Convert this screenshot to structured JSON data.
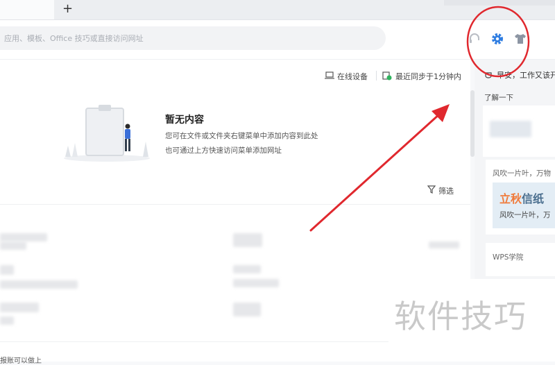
{
  "tabbar": {
    "new_tab_label": "+"
  },
  "toolbar": {
    "search_placeholder": "应用、模板、Office 技巧或直接访问网址",
    "icons": [
      "headset-icon",
      "gear-icon",
      "skin-shirt-icon"
    ],
    "accent": "#2f7de1"
  },
  "main": {
    "online_devices": "在线设备",
    "sync_status": "最近同步于1分钟内",
    "empty_title": "暂无内容",
    "empty_line1": "您可在文件或文件夹右键菜单中添加内容到此处",
    "empty_line2": "也可通过上方快速访问菜单添加网址",
    "filter_label": "筛选"
  },
  "right_panel": {
    "greeting": "早安，工作又该开",
    "learn_more": "了解一下",
    "feed_title": "风吹一片叶，万物",
    "promo_title_orange": "立秋",
    "promo_title_blue": "信纸",
    "promo_sub": "风吹一片叶，万",
    "academy": "WPS学院"
  },
  "watermark": "软件技巧",
  "annotation": {
    "color": "#e0282e"
  },
  "bottom": {
    "partial_text": "报账可以做上"
  }
}
